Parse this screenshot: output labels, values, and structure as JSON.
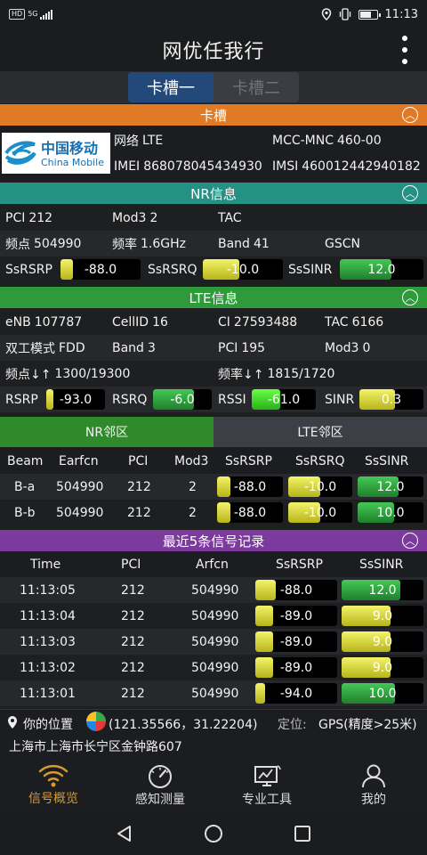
{
  "status_bar": {
    "left_badges": [
      "HD",
      "5G"
    ],
    "time": "11:13"
  },
  "app": {
    "title": "网优任我行"
  },
  "sim_tabs": [
    {
      "label": "卡槽一",
      "active": true
    },
    {
      "label": "卡槽二",
      "active": false
    }
  ],
  "sim_section": {
    "header": "卡槽",
    "operator_logo_cn": "中国移动",
    "operator_logo_en": "China Mobile",
    "network_label": "网络",
    "network_value": "LTE",
    "mcc_label": "MCC-MNC",
    "mcc_value": "460-00",
    "imei_label": "IMEI",
    "imei_value": "868078045434930",
    "imsi_label": "IMSI",
    "imsi_value": "460012442940182"
  },
  "nr_section": {
    "header": "NR信息",
    "pci_label": "PCI",
    "pci_value": "212",
    "mod3_label": "Mod3",
    "mod3_value": "2",
    "tac_label": "TAC",
    "tac_value": "",
    "freq_point_label": "频点",
    "freq_point_value": "504990",
    "freq_label": "频率",
    "freq_value": "1.6GHz",
    "band_label": "Band",
    "band_value": "41",
    "gscn_label": "GSCN",
    "gscn_value": "",
    "ssrsrp_label": "SsRSRP",
    "ssrsrp_value": "-88.0",
    "ssrsrp_level": 0.15,
    "ssrsrp_color": "#e6e54a",
    "ssrsrq_label": "SsRSRQ",
    "ssrsrq_value": "-10.0",
    "ssrsrq_level": 0.45,
    "ssrsrq_color": "#e6e54a",
    "sssinr_label": "SsSINR",
    "sssinr_value": "12.0",
    "sssinr_level": 0.62,
    "sssinr_color": "#3aa846"
  },
  "lte_section": {
    "header": "LTE信息",
    "enb_label": "eNB",
    "enb_value": "107787",
    "cellid_label": "CellID",
    "cellid_value": "16",
    "ci_label": "CI",
    "ci_value": "27593488",
    "tac_label": "TAC",
    "tac_value": "6166",
    "duplex_label": "双工模式",
    "duplex_value": "FDD",
    "band_label": "Band",
    "band_value": "3",
    "pci_label": "PCI",
    "pci_value": "195",
    "mod3_label": "Mod3",
    "mod3_value": "0",
    "earfcn_label": "频点↓↑",
    "earfcn_value": "1300/19300",
    "freq_label": "频率↓↑",
    "freq_value": "1815/1720",
    "rsrp_label": "RSRP",
    "rsrp_value": "-93.0",
    "rsrp_level": 0.12,
    "rsrp_color": "#e6e54a",
    "rsrq_label": "RSRQ",
    "rsrq_value": "-6.0",
    "rsrq_level": 0.7,
    "rsrq_color": "#3aa846",
    "rssi_label": "RSSI",
    "rssi_value": "-61.0",
    "rssi_level": 0.45,
    "rssi_color": "#4be038",
    "sinr_label": "SINR",
    "sinr_value": "0.3",
    "sinr_level": 0.55,
    "sinr_color": "#e6e54a"
  },
  "neighbor_tabs": [
    {
      "label": "NR邻区",
      "active": true
    },
    {
      "label": "LTE邻区",
      "active": false
    }
  ],
  "neighbor_table": {
    "columns": [
      "Beam",
      "Earfcn",
      "PCI",
      "Mod3",
      "SsRSRP",
      "SsRSRQ",
      "SsSINR"
    ],
    "rows": [
      {
        "beam": "B-a",
        "earfcn": "504990",
        "pci": "212",
        "mod3": "2",
        "ssrsrp": "-88.0",
        "ssrsrp_level": 0.2,
        "ssrsrq": "-10.0",
        "ssrsrq_level": 0.5,
        "sssinr": "12.0",
        "sssinr_level": 0.62
      },
      {
        "beam": "B-b",
        "earfcn": "504990",
        "pci": "212",
        "mod3": "2",
        "ssrsrp": "-88.0",
        "ssrsrp_level": 0.2,
        "ssrsrq": "-10.0",
        "ssrsrq_level": 0.5,
        "sssinr": "10.0",
        "sssinr_level": 0.55
      }
    ]
  },
  "history": {
    "header": "最近5条信号记录",
    "columns": [
      "Time",
      "PCI",
      "Arfcn",
      "SsRSRP",
      "SsSINR"
    ],
    "rows": [
      {
        "time": "11:13:05",
        "pci": "212",
        "arfcn": "504990",
        "ssrsrp": "-88.0",
        "ssrsrp_level": 0.25,
        "sssinr": "12.0",
        "sssinr_level": 0.72,
        "sinr_color": "#3aa846"
      },
      {
        "time": "11:13:04",
        "pci": "212",
        "arfcn": "504990",
        "ssrsrp": "-89.0",
        "ssrsrp_level": 0.22,
        "sssinr": "9.0",
        "sssinr_level": 0.6,
        "sinr_color": "#e6e54a"
      },
      {
        "time": "11:13:03",
        "pci": "212",
        "arfcn": "504990",
        "ssrsrp": "-89.0",
        "ssrsrp_level": 0.22,
        "sssinr": "9.0",
        "sssinr_level": 0.6,
        "sinr_color": "#e6e54a"
      },
      {
        "time": "11:13:02",
        "pci": "212",
        "arfcn": "504990",
        "ssrsrp": "-89.0",
        "ssrsrp_level": 0.22,
        "sssinr": "9.0",
        "sssinr_level": 0.6,
        "sinr_color": "#e6e54a"
      },
      {
        "time": "11:13:01",
        "pci": "212",
        "arfcn": "504990",
        "ssrsrp": "-94.0",
        "ssrsrp_level": 0.12,
        "sssinr": "10.0",
        "sssinr_level": 0.65,
        "sinr_color": "#3aa846"
      }
    ]
  },
  "location": {
    "label": "你的位置",
    "coords": "(121.35566，31.22204)",
    "positioning_label": "定位:",
    "positioning_value": "GPS(精度>25米)",
    "address": "上海市上海市长宁区金钟路607"
  },
  "bottom_nav": [
    {
      "label": "信号概览",
      "icon": "wifi-signal-icon",
      "active": true
    },
    {
      "label": "感知测量",
      "icon": "speedometer-icon",
      "active": false
    },
    {
      "label": "专业工具",
      "icon": "chart-monitor-icon",
      "active": false
    },
    {
      "label": "我的",
      "icon": "user-icon",
      "active": false
    }
  ],
  "colors": {
    "sim_header": "#e07a24",
    "nr_header": "#259185",
    "lte_header": "#2f9a3a",
    "history_header": "#7b3a9c",
    "active_nav": "#d69b2e"
  }
}
